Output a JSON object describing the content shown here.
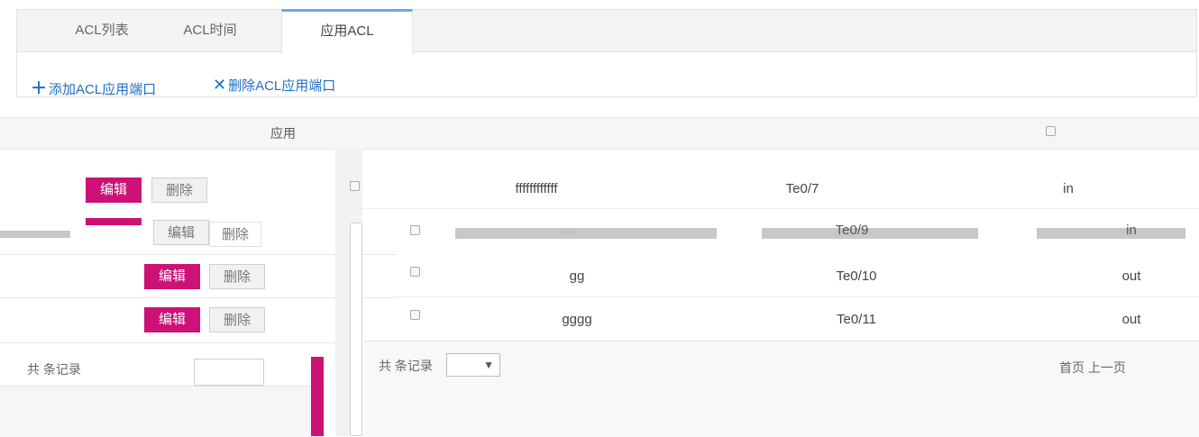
{
  "tabs": [
    {
      "label": "ACL列表"
    },
    {
      "label": "ACL时间"
    },
    {
      "label": "应用ACL"
    }
  ],
  "toolbar": {
    "add_label": "添加ACL应用端口",
    "add_icon": "plus-icon",
    "delete_label": "删除ACL应用端口",
    "delete_icon": "x-icon"
  },
  "left_actions": {
    "edit_label": "编辑",
    "delete_label": "删除"
  },
  "table": {
    "header_fragment": "应用",
    "rows": [
      {
        "name": "ffffffffffff",
        "port": "Te0/7",
        "direction": "in"
      },
      {
        "name": "....",
        "port": "Te0/9",
        "direction": "in"
      },
      {
        "name": "gg",
        "port": "Te0/10",
        "direction": "out"
      },
      {
        "name": "gggg",
        "port": "Te0/11",
        "direction": "out"
      }
    ]
  },
  "pagination": {
    "left_text": "共 条记录",
    "right_text": "首页 上一页"
  },
  "colors": {
    "edit_bg": "#cc1177",
    "link": "#1f6fc0",
    "active_tab_border": "#69a8e8"
  }
}
